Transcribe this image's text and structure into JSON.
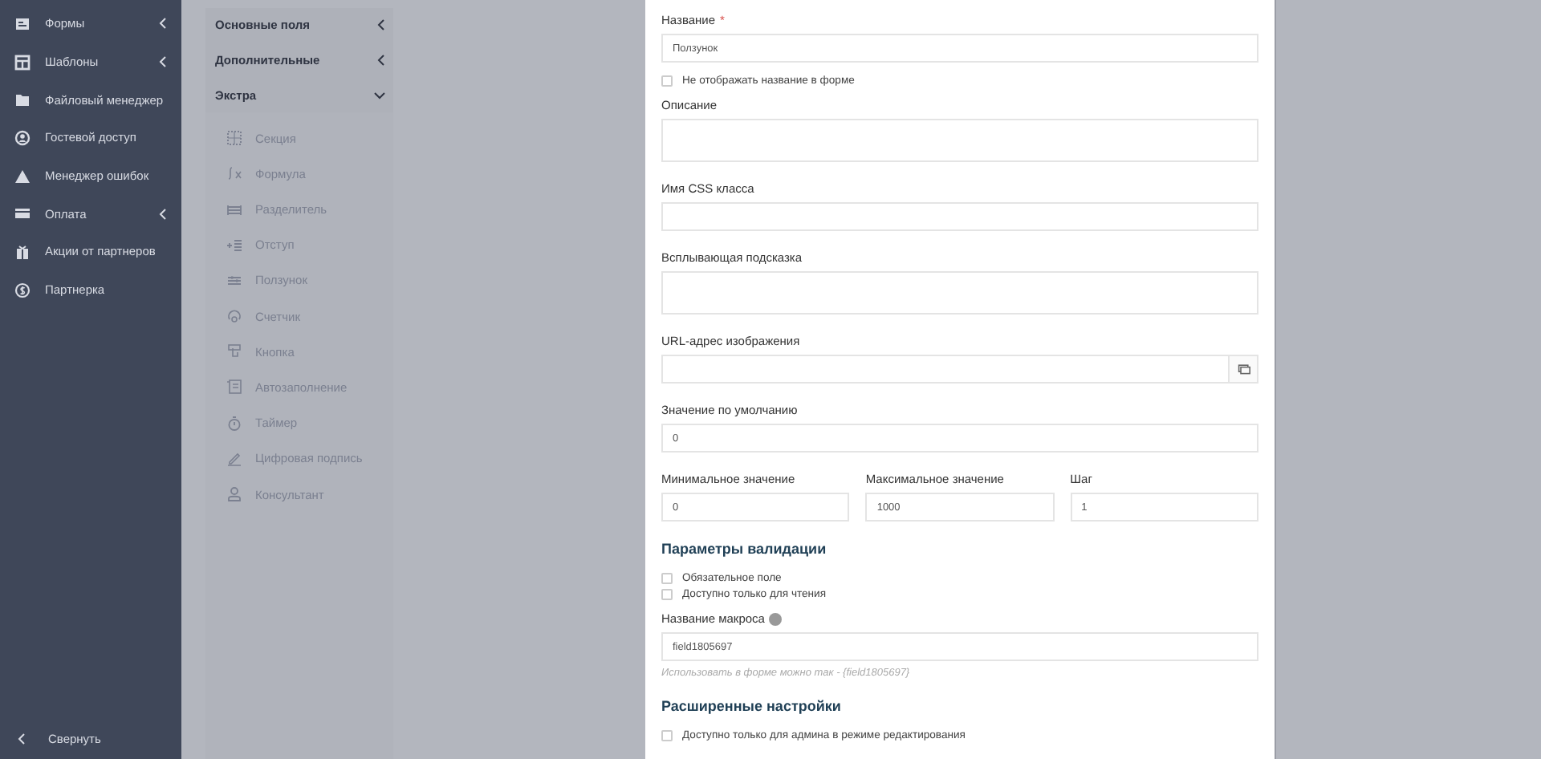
{
  "sidebar": {
    "items": [
      {
        "label": "Формы",
        "expandable": true
      },
      {
        "label": "Шаблоны",
        "expandable": true
      },
      {
        "label": "Файловый менеджер",
        "expandable": false
      },
      {
        "label": "Гостевой доступ",
        "expandable": false
      },
      {
        "label": "Менеджер ошибок",
        "expandable": false
      },
      {
        "label": "Оплата",
        "expandable": true
      },
      {
        "label": "Акции от партнеров",
        "expandable": false
      },
      {
        "label": "Партнерка",
        "expandable": false
      }
    ],
    "collapse": "Свернуть"
  },
  "palette": {
    "groups": [
      {
        "label": "Основные поля",
        "expanded": false
      },
      {
        "label": "Дополнительные",
        "expanded": false
      },
      {
        "label": "Экстра",
        "expanded": true
      }
    ],
    "items": [
      "Секция",
      "Формула",
      "Разделитель",
      "Отступ",
      "Ползунок",
      "Счетчик",
      "Кнопка",
      "Автозаполнение",
      "Таймер",
      "Цифровая подпись",
      "Консультант"
    ]
  },
  "form": {
    "fields": [
      {
        "kind": "input",
        "label": "Название",
        "required_mark": "*",
        "value": "Ползунок"
      },
      {
        "kind": "checkbox",
        "label": "Не отображать название в форме",
        "checked": false
      },
      {
        "kind": "textarea",
        "label": "Описание"
      },
      {
        "kind": "input",
        "label": "Имя CSS класса"
      },
      {
        "kind": "textarea",
        "label": "Всплывающая подсказка"
      },
      {
        "kind": "input_button",
        "label": "URL-адрес изображения"
      },
      {
        "kind": "input",
        "label": "Значение по умолчанию",
        "value": "0"
      },
      {
        "kind": "row",
        "fields": [
          {
            "label": "Минимальное значение",
            "value": "0"
          },
          {
            "label": "Максимальное значение",
            "value": "1000"
          },
          {
            "label": "Шаг",
            "value": "1"
          }
        ]
      },
      {
        "kind": "heading",
        "label": "Параметры валидации"
      },
      {
        "kind": "checkbox",
        "label": "Обязательное поле",
        "checked": false
      },
      {
        "kind": "checkbox",
        "label": "Доступно только для чтения",
        "checked": false
      },
      {
        "kind": "input",
        "label": "Название макроса",
        "help": true,
        "value": "field1805697",
        "hint": "Использовать в форме можно так - {field1805697}"
      },
      {
        "kind": "heading",
        "label": "Расширенные настройки"
      },
      {
        "kind": "checkbox",
        "label": "Доступно только для админа в режиме редактирования",
        "checked": false
      }
    ]
  }
}
